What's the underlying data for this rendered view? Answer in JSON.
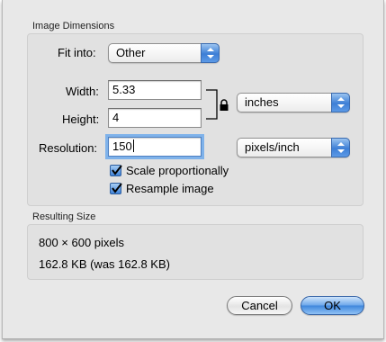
{
  "image_dimensions": {
    "title": "Image Dimensions",
    "fit_into": {
      "label": "Fit into:",
      "value": "Other"
    },
    "width": {
      "label": "Width:",
      "value": "5.33"
    },
    "height": {
      "label": "Height:",
      "value": "4"
    },
    "units": {
      "value": "inches"
    },
    "resolution": {
      "label": "Resolution:",
      "value": "150",
      "unit": "pixels/inch"
    },
    "scale_proportionally": {
      "label": "Scale proportionally",
      "checked": true
    },
    "resample_image": {
      "label": "Resample image",
      "checked": true
    }
  },
  "resulting_size": {
    "title": "Resulting Size",
    "pixels": "800 × 600 pixels",
    "file_size": "162.8 KB (was 162.8 KB)"
  },
  "buttons": {
    "cancel": "Cancel",
    "ok": "OK"
  },
  "icons": {
    "lock": "lock-icon",
    "popup_arrows": "popup-arrows-icon",
    "checkmark": "checkmark-icon"
  },
  "colors": {
    "accent": "#3d7fd6",
    "focus_ring": "#7fb2ea",
    "sheet_bg": "#e8e8e8"
  }
}
